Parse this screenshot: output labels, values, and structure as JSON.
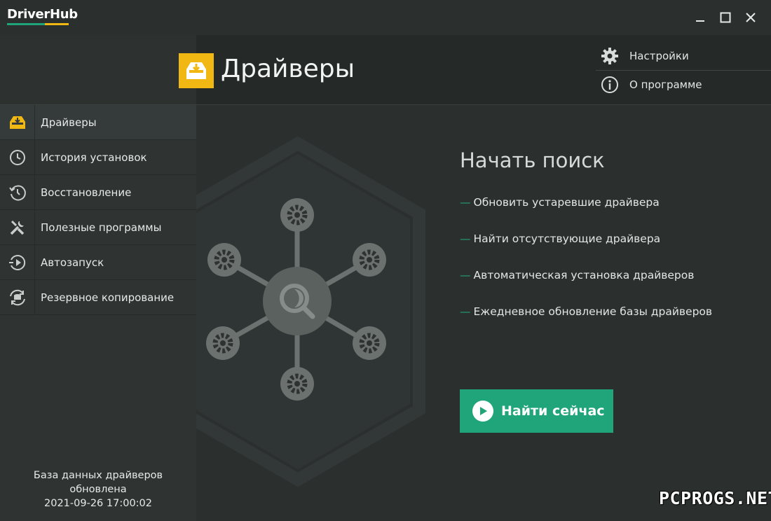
{
  "app": {
    "name": "DriverHub",
    "accent_green": "#1fa579",
    "accent_yellow": "#f1b712"
  },
  "window_controls": {
    "minimize": "minimize-icon",
    "maximize": "maximize-icon",
    "close": "close-icon"
  },
  "header": {
    "title": "Драйверы",
    "links": [
      {
        "label": "Настройки",
        "icon": "gear-icon"
      },
      {
        "label": "О программе",
        "icon": "info-icon"
      }
    ]
  },
  "sidebar": {
    "items": [
      {
        "label": "Драйверы",
        "icon": "drivers-tray-icon",
        "active": true
      },
      {
        "label": "История установок",
        "icon": "clock-icon"
      },
      {
        "label": "Восстановление",
        "icon": "restore-history-icon"
      },
      {
        "label": "Полезные программы",
        "icon": "tools-icon"
      },
      {
        "label": "Автозапуск",
        "icon": "autorun-icon"
      },
      {
        "label": "Резервное копирование",
        "icon": "backup-icon"
      }
    ],
    "db_status": {
      "line1": "База данных драйверов",
      "line2": "обновлена",
      "timestamp": "2021-09-26 17:00:02"
    }
  },
  "main": {
    "heading": "Начать поиск",
    "features": [
      "Обновить устаревшие драйвера",
      "Найти отсутствующие драйвера",
      "Автоматическая установка драйверов",
      "Ежедневное обновление базы драйверов"
    ],
    "cta_label": "Найти сейчас"
  },
  "watermark": "PCPROGS.NET"
}
